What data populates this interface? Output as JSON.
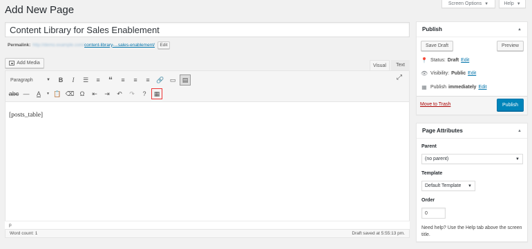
{
  "header": {
    "title": "Add New Page",
    "screen_options": "Screen Options",
    "help": "Help"
  },
  "post": {
    "title": "Content Library for Sales Enablement",
    "permalink_label": "Permalink:",
    "permalink_base": "http://demo.example.com/",
    "permalink_slug": "content-library-...sales-enablement/",
    "edit_label": "Edit"
  },
  "editor": {
    "add_media": "Add Media",
    "tab_visual": "Visual",
    "tab_text": "Text",
    "format": "Paragraph",
    "content": "[posts_table]",
    "path": "p",
    "word_count": "Word count: 1",
    "draft_saved": "Draft saved at 5:55:13 pm."
  },
  "publish": {
    "title": "Publish",
    "save_draft": "Save Draft",
    "preview": "Preview",
    "status_label": "Status:",
    "status_value": "Draft",
    "visibility_label": "Visibility:",
    "visibility_value": "Public",
    "publish_label": "Publish",
    "publish_value": "immediately",
    "edit": "Edit",
    "move_to_trash": "Move to Trash",
    "publish_button": "Publish"
  },
  "attributes": {
    "title": "Page Attributes",
    "parent_label": "Parent",
    "parent_value": "(no parent)",
    "template_label": "Template",
    "template_value": "Default Template",
    "order_label": "Order",
    "order_value": "0",
    "help_text": "Need help? Use the Help tab above the screen title."
  }
}
